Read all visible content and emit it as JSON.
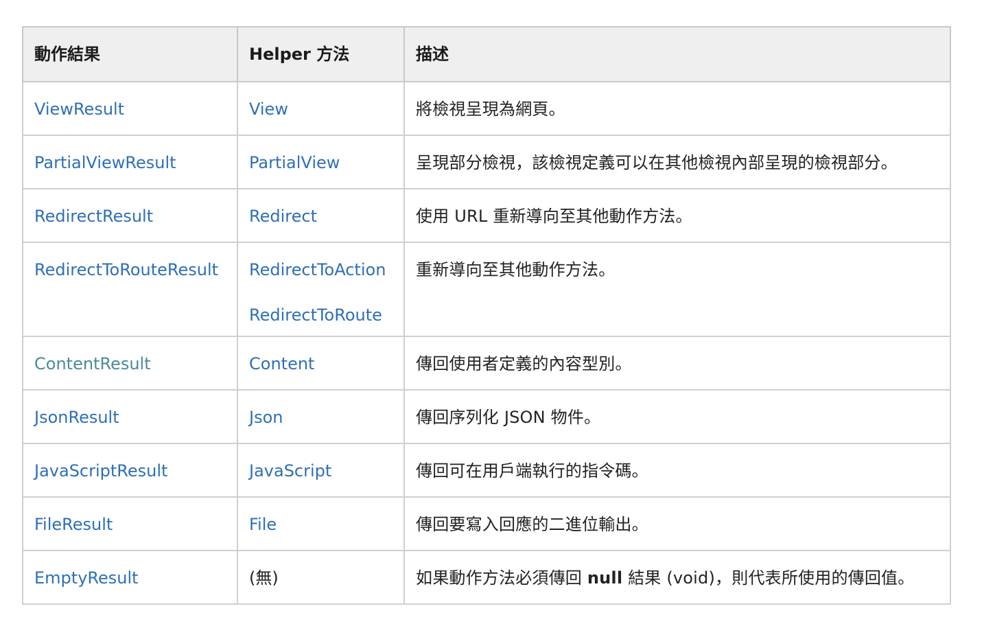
{
  "table": {
    "headers": [
      "動作結果",
      "Helper 方法",
      "描述"
    ],
    "rows": [
      {
        "result": "ViewResult",
        "helpers": [
          "View"
        ],
        "description": "將檢視呈現為網頁。"
      },
      {
        "result": "PartialViewResult",
        "helpers": [
          "PartialView"
        ],
        "description": "呈現部分檢視，該檢視定義可以在其他檢視內部呈現的檢視部分。"
      },
      {
        "result": "RedirectResult",
        "helpers": [
          "Redirect"
        ],
        "description": "使用 URL 重新導向至其他動作方法。"
      },
      {
        "result": "RedirectToRouteResult",
        "helpers": [
          "RedirectToAction",
          "RedirectToRoute"
        ],
        "description": "重新導向至其他動作方法。"
      },
      {
        "result": "ContentResult",
        "helpers": [
          "Content"
        ],
        "description": "傳回使用者定義的內容型別。"
      },
      {
        "result": "JsonResult",
        "helpers": [
          "Json"
        ],
        "description": "傳回序列化 JSON 物件。"
      },
      {
        "result": "JavaScriptResult",
        "helpers": [
          "JavaScript"
        ],
        "description": "傳回可在用戶端執行的指令碼。"
      },
      {
        "result": "FileResult",
        "helpers": [
          "File"
        ],
        "description": "傳回要寫入回應的二進位輸出。"
      },
      {
        "result": "EmptyResult",
        "helpers": [
          "(無)"
        ],
        "description_before": "如果動作方法必須傳回 ",
        "description_bold": "null",
        "description_after": " 結果 (void)，則代表所使用的傳回值。"
      }
    ]
  },
  "colors": {
    "link": "#2e6fb7",
    "visited_link": "#4a8a9a",
    "header_bg": "#efefef",
    "border": "#cfcfcf"
  }
}
